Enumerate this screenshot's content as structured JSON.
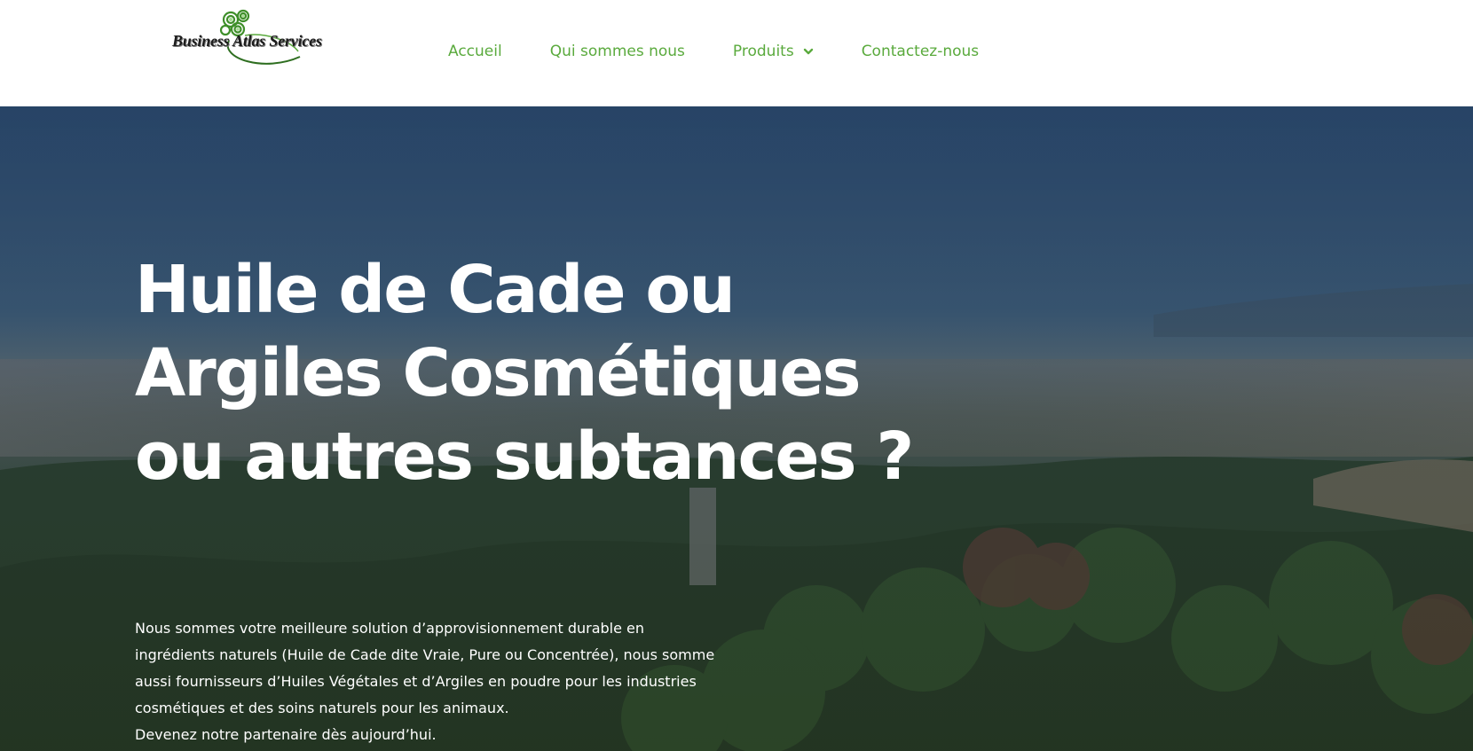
{
  "logo": {
    "text": "Business Atlas Services"
  },
  "nav": {
    "items": [
      {
        "label": "Accueil"
      },
      {
        "label": "Qui sommes nous"
      },
      {
        "label": "Produits"
      },
      {
        "label": "Contactez-nous"
      }
    ]
  },
  "hero": {
    "title_lines": [
      "Huile de Cade ou",
      "Argiles Cosmétiques",
      "ou autres subtances ?"
    ],
    "text_lines": [
      "Nous sommes votre meilleure solution d’approvisionnement durable en",
      "ingrédients naturels (Huile de Cade dite Vraie, Pure ou Concentrée), nous somme",
      "aussi fournisseurs d’Huiles Végétales et d’Argiles en poudre pour les industries",
      "cosmétiques et des soins naturels pour les animaux.",
      "Devenez notre partenaire dès aujourd’hui."
    ]
  },
  "colors": {
    "nav": "#5aaa3d",
    "hero_overlay": "#1c3456",
    "title": "#ffffff"
  },
  "icons": {
    "dropdown": "chevron-down-icon",
    "logo": "green-spiral-logo"
  }
}
